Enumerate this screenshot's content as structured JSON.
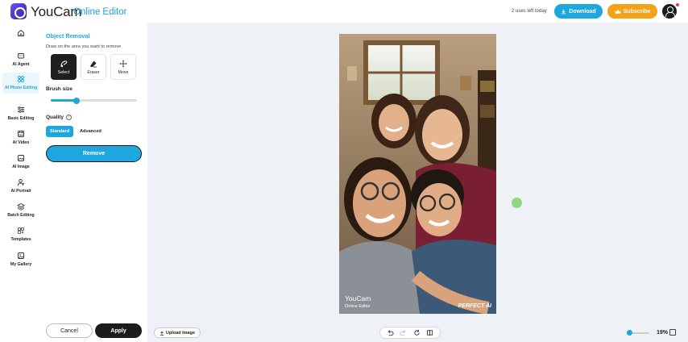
{
  "header": {
    "brand": "YouCam",
    "brand_sub": "Online Editor",
    "uses_left": "2 uses left today",
    "download_label": "Download",
    "subscribe_label": "Subscribe"
  },
  "sidebar": {
    "items": [
      {
        "label": "",
        "icon": "home-icon"
      },
      {
        "label": "AI Agent",
        "icon": "ai-agent-icon"
      },
      {
        "label": "AI Photo Editing",
        "icon": "ai-photo-editing-icon"
      },
      {
        "label": "Basic Editing",
        "icon": "sliders-icon"
      },
      {
        "label": "AI Video",
        "icon": "video-icon"
      },
      {
        "label": "AI Image",
        "icon": "image-icon"
      },
      {
        "label": "AI Portrait",
        "icon": "portrait-icon"
      },
      {
        "label": "Batch Editing",
        "icon": "layers-icon"
      },
      {
        "label": "Templates",
        "icon": "templates-icon"
      },
      {
        "label": "My Gallery",
        "icon": "gallery-icon"
      }
    ]
  },
  "panel": {
    "title": "Object Removal",
    "hint": "Draw on the area you want to remove",
    "tools": [
      {
        "label": "Select",
        "icon": "select-brush-icon",
        "active": true
      },
      {
        "label": "Eraser",
        "icon": "eraser-icon",
        "active": false
      },
      {
        "label": "Move",
        "icon": "move-icon",
        "active": false
      }
    ],
    "brush_size_label": "Brush size",
    "brush_size_fraction": 0.3,
    "quality_label": "Quality",
    "quality_options": [
      "Standard",
      "Advanced"
    ],
    "quality_selected": "Standard",
    "remove_label": "Remove",
    "cancel_label": "Cancel",
    "apply_label": "Apply"
  },
  "canvas": {
    "watermark_brand": "YouCam",
    "watermark_sub": "Online Editor",
    "watermark_ai": "PERFECT AI",
    "upload_label": "Upload Image",
    "zoom": "19%"
  },
  "colors": {
    "accent": "#1ea6de",
    "subscribe": "#f4a21a",
    "dark_button": "#1c1c1c",
    "canvas_bg": "#eef1f5"
  }
}
